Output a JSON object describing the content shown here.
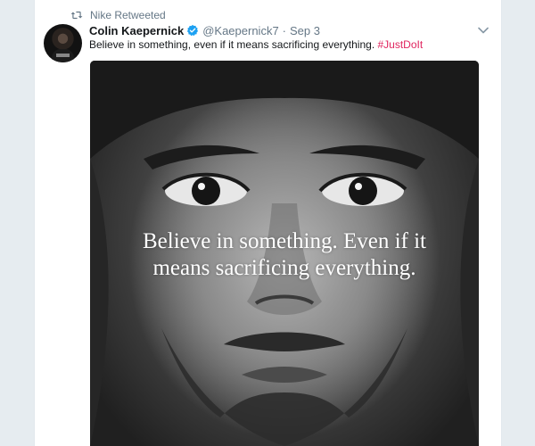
{
  "retweet": {
    "label": "Nike Retweeted"
  },
  "tweet": {
    "author_name": "Colin Kaepernick",
    "handle": "@Kaepernick7",
    "separator": "·",
    "timestamp": "Sep 3",
    "text": "Believe in something, even if it means sacrificing everything.",
    "hashtag": "#JustDoIt"
  },
  "photo": {
    "quote_line1": "Believe in something. Even if it",
    "quote_line2": "means sacrificing everything."
  },
  "icons": {
    "retweet": "retweet-icon",
    "verified": "verified-badge-icon",
    "more": "chevron-down-icon"
  },
  "colors": {
    "hashtag": "#e0245e",
    "verified": "#1da1f2",
    "muted": "#657786"
  }
}
